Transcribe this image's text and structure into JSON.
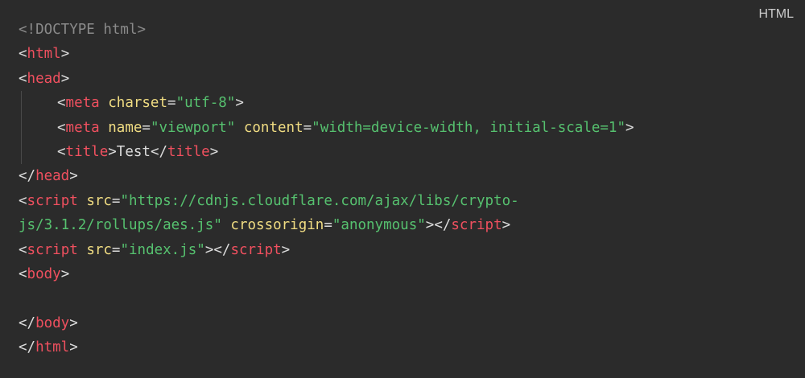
{
  "language_label": "HTML",
  "colors": {
    "background": "#2b2b2b",
    "tag": "#f0505f",
    "attribute": "#f0dc82",
    "string": "#56c16f",
    "doctype": "#8a8a8a",
    "text": "#dcdcdc"
  },
  "code": {
    "doctype": "<!DOCTYPE html>",
    "tags": {
      "html": "html",
      "head": "head",
      "meta": "meta",
      "title": "title",
      "script": "script",
      "body": "body"
    },
    "meta1_attr": "charset",
    "meta1_val": "\"utf-8\"",
    "meta2_attr1": "name",
    "meta2_val1": "\"viewport\"",
    "meta2_attr2": "content",
    "meta2_val2": "\"width=device-width, initial-scale=1\"",
    "title_text": "Test",
    "script1_attr1": "src",
    "script1_val1_part1": "\"https://cdnjs.cloudflare.com/ajax/libs/crypto-",
    "script1_val1_part2": "js/3.1.2/rollups/aes.js\"",
    "script1_attr2": "crossorigin",
    "script1_val2": "\"anonymous\"",
    "script2_attr": "src",
    "script2_val": "\"index.js\""
  }
}
